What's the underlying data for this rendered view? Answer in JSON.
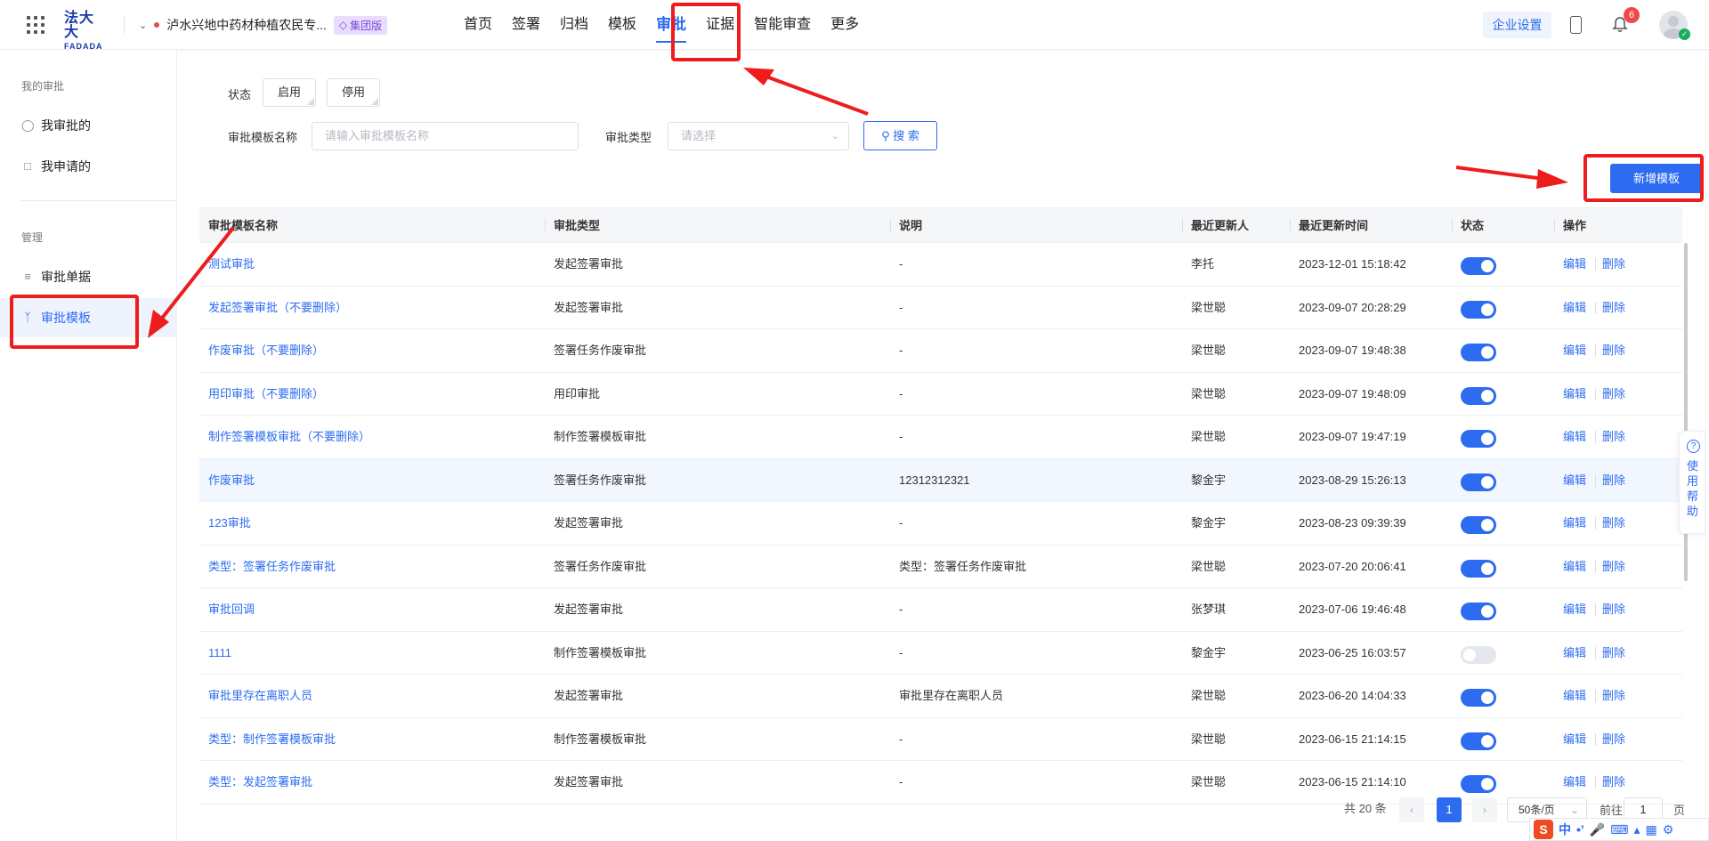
{
  "header": {
    "logo_cn": "法大大",
    "logo_en": "FADADA",
    "company": "泸水兴地中药材种植农民专...",
    "edition": "集团版",
    "nav": [
      "首页",
      "签署",
      "归档",
      "模板",
      "审批",
      "证据",
      "智能审查",
      "更多"
    ],
    "active_nav": "审批",
    "enterprise_settings": "企业设置",
    "notification_count": "6"
  },
  "sidebar": {
    "section_mine": "我的审批",
    "item_approved_by_me": "我审批的",
    "item_applied_by_me": "我申请的",
    "section_manage": "管理",
    "item_forms": "审批单据",
    "item_templates": "审批模板"
  },
  "filters": {
    "status_label": "状态",
    "status_enabled": "启用",
    "status_disabled": "停用",
    "name_label": "审批模板名称",
    "name_placeholder": "请输入审批模板名称",
    "type_label": "审批类型",
    "type_placeholder": "请选择",
    "search_button": "搜 索",
    "new_button": "新增模板"
  },
  "table": {
    "columns": [
      "审批模板名称",
      "审批类型",
      "说明",
      "最近更新人",
      "最近更新时间",
      "状态",
      "操作"
    ],
    "edit_label": "编辑",
    "delete_label": "删除",
    "rows": [
      {
        "name": "测试审批",
        "type": "发起签署审批",
        "desc": "-",
        "updater": "李托",
        "time": "2023-12-01 15:18:42",
        "enabled": true
      },
      {
        "name": "发起签署审批（不要删除）",
        "type": "发起签署审批",
        "desc": "-",
        "updater": "梁世聪",
        "time": "2023-09-07 20:28:29",
        "enabled": true
      },
      {
        "name": "作废审批（不要删除）",
        "type": "签署任务作废审批",
        "desc": "-",
        "updater": "梁世聪",
        "time": "2023-09-07 19:48:38",
        "enabled": true
      },
      {
        "name": "用印审批（不要删除）",
        "type": "用印审批",
        "desc": "-",
        "updater": "梁世聪",
        "time": "2023-09-07 19:48:09",
        "enabled": true
      },
      {
        "name": "制作签署模板审批（不要删除）",
        "type": "制作签署模板审批",
        "desc": "-",
        "updater": "梁世聪",
        "time": "2023-09-07 19:47:19",
        "enabled": true
      },
      {
        "name": "作废审批",
        "type": "签署任务作废审批",
        "desc": "12312312321",
        "updater": "黎金宇",
        "time": "2023-08-29 15:26:13",
        "enabled": true
      },
      {
        "name": "123审批",
        "type": "发起签署审批",
        "desc": "-",
        "updater": "黎金宇",
        "time": "2023-08-23 09:39:39",
        "enabled": true
      },
      {
        "name": "类型：签署任务作废审批",
        "type": "签署任务作废审批",
        "desc": "类型：签署任务作废审批",
        "updater": "梁世聪",
        "time": "2023-07-20 20:06:41",
        "enabled": true
      },
      {
        "name": "审批回调",
        "type": "发起签署审批",
        "desc": "-",
        "updater": "张梦琪",
        "time": "2023-07-06 19:46:48",
        "enabled": true
      },
      {
        "name": "1111",
        "type": "制作签署模板审批",
        "desc": "-",
        "updater": "黎金宇",
        "time": "2023-06-25 16:03:57",
        "enabled": false
      },
      {
        "name": "审批里存在离职人员",
        "type": "发起签署审批",
        "desc": "审批里存在离职人员",
        "updater": "梁世聪",
        "time": "2023-06-20 14:04:33",
        "enabled": true
      },
      {
        "name": "类型：制作签署模板审批",
        "type": "制作签署模板审批",
        "desc": "-",
        "updater": "梁世聪",
        "time": "2023-06-15 21:14:15",
        "enabled": true
      },
      {
        "name": "类型：发起签署审批",
        "type": "发起签署审批",
        "desc": "-",
        "updater": "梁世聪",
        "time": "2023-06-15 21:14:10",
        "enabled": true
      }
    ]
  },
  "pagination": {
    "total": "共 20 条",
    "current_page": "1",
    "page_size": "50条/页",
    "goto_prefix": "前往",
    "goto_value": "1",
    "goto_suffix": "页"
  },
  "help": {
    "text": "使用帮助"
  },
  "ime": {
    "logo": "S",
    "mode": "中"
  },
  "colors": {
    "primary": "#2d6cf0",
    "annotation_red": "#ee1c1c"
  }
}
